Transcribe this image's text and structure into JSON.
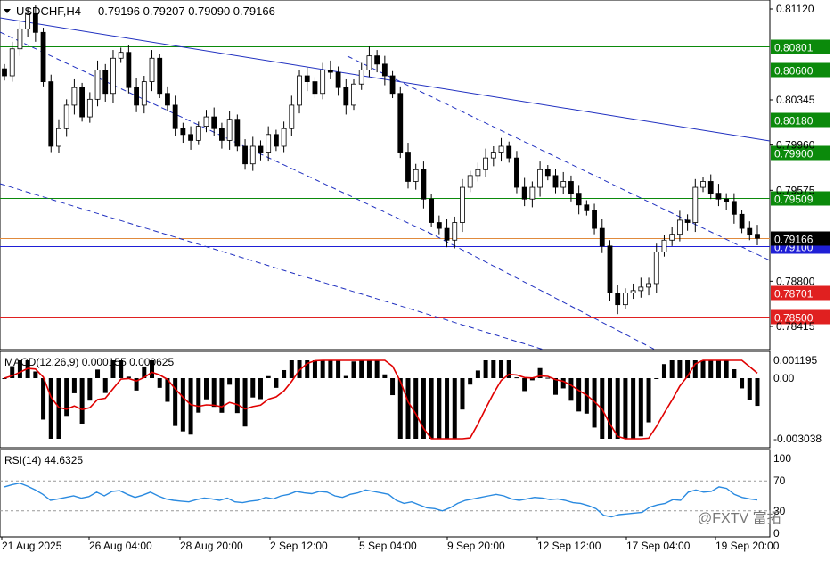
{
  "header": {
    "symbol": "USDCHF,H4",
    "ohlc": "0.79196 0.79207 0.79090 0.79166"
  },
  "price_axis": {
    "ticks": [
      "0.81120",
      "0.80801",
      "0.80600",
      "0.80345",
      "0.80180",
      "0.79960",
      "0.79900",
      "0.79575",
      "0.79509",
      "0.79166",
      "0.79100",
      "0.78800",
      "0.78701",
      "0.78500",
      "0.78415"
    ]
  },
  "levels": [
    {
      "value": 0.80801,
      "label": "0.80801",
      "color": "#0b8a0b"
    },
    {
      "value": 0.806,
      "label": "0.80600",
      "color": "#0b8a0b"
    },
    {
      "value": 0.8018,
      "label": "0.80180",
      "color": "#0b8a0b"
    },
    {
      "value": 0.799,
      "label": "0.79900",
      "color": "#0b8a0b"
    },
    {
      "value": 0.79509,
      "label": "0.79509",
      "color": "#0b8a0b"
    },
    {
      "value": 0.791,
      "label": "0.79100",
      "color": "#1f1fd6"
    },
    {
      "value": 0.78701,
      "label": "0.78701",
      "color": "#e02020"
    },
    {
      "value": 0.785,
      "label": "0.78500",
      "color": "#e02020"
    }
  ],
  "current_price": {
    "value": 0.79166,
    "label": "0.79166",
    "color": "#e08a3c"
  },
  "macd": {
    "label": "MACD(12,26,9) 0.000155 0.000625",
    "ticks": [
      "0.001195",
      "0.00",
      "-0.003038"
    ]
  },
  "rsi": {
    "label": "RSI(14) 44.6325",
    "ticks": [
      "100",
      "70",
      "30",
      "0"
    ]
  },
  "time_axis": {
    "labels": [
      "21 Aug 2025",
      "26 Aug 04:00",
      "28 Aug 20:00",
      "2 Sep 12:00",
      "5 Sep 04:00",
      "9 Sep 20:00",
      "12 Sep 12:00",
      "17 Sep 04:00",
      "19 Sep 20:00"
    ]
  },
  "watermark": "@FXTV 富拓",
  "chart_data": {
    "type": "candlestick",
    "symbol": "USDCHF",
    "timeframe": "H4",
    "y_range": [
      0.7835,
      0.8115
    ],
    "candle_closes": [
      0.8055,
      0.8078,
      0.8095,
      0.8108,
      0.8092,
      0.805,
      0.7995,
      0.801,
      0.803,
      0.8045,
      0.802,
      0.8035,
      0.806,
      0.804,
      0.807,
      0.8075,
      0.8045,
      0.803,
      0.805,
      0.807,
      0.804,
      0.803,
      0.801,
      0.8005,
      0.8,
      0.8012,
      0.802,
      0.801,
      0.8,
      0.8018,
      0.7995,
      0.798,
      0.7995,
      0.799,
      0.8005,
      0.7995,
      0.801,
      0.803,
      0.8055,
      0.805,
      0.804,
      0.806,
      0.8058,
      0.8045,
      0.803,
      0.8048,
      0.806,
      0.8072,
      0.8065,
      0.8055,
      0.804,
      0.799,
      0.7965,
      0.7975,
      0.795,
      0.793,
      0.7925,
      0.7915,
      0.793,
      0.796,
      0.797,
      0.7975,
      0.7985,
      0.799,
      0.7995,
      0.7985,
      0.796,
      0.795,
      0.796,
      0.7975,
      0.797,
      0.796,
      0.7965,
      0.7955,
      0.7945,
      0.794,
      0.7925,
      0.791,
      0.787,
      0.786,
      0.787,
      0.7872,
      0.7875,
      0.7878,
      0.7905,
      0.7915,
      0.792,
      0.7932,
      0.793,
      0.796,
      0.7965,
      0.7955,
      0.795,
      0.7948,
      0.7937,
      0.7925,
      0.792,
      0.79166
    ],
    "rsi_values": [
      62,
      65,
      67,
      63,
      58,
      52,
      44,
      46,
      48,
      50,
      47,
      49,
      55,
      50,
      56,
      57,
      52,
      48,
      51,
      55,
      50,
      46,
      44,
      43,
      42,
      45,
      47,
      46,
      44,
      47,
      42,
      41,
      43,
      44,
      48,
      46,
      50,
      52,
      56,
      54,
      53,
      56,
      55,
      50,
      48,
      52,
      54,
      58,
      56,
      54,
      52,
      44,
      40,
      42,
      38,
      34,
      33,
      30,
      34,
      40,
      44,
      46,
      48,
      50,
      52,
      50,
      46,
      44,
      46,
      48,
      47,
      45,
      46,
      44,
      41,
      40,
      37,
      33,
      24,
      22,
      25,
      26,
      27,
      28,
      35,
      38,
      40,
      45,
      44,
      55,
      58,
      55,
      56,
      62,
      60,
      52,
      48,
      46,
      44.63
    ],
    "macd_hist_range": [
      -0.003038,
      0.001195
    ],
    "rsi_levels": [
      30,
      70
    ]
  }
}
